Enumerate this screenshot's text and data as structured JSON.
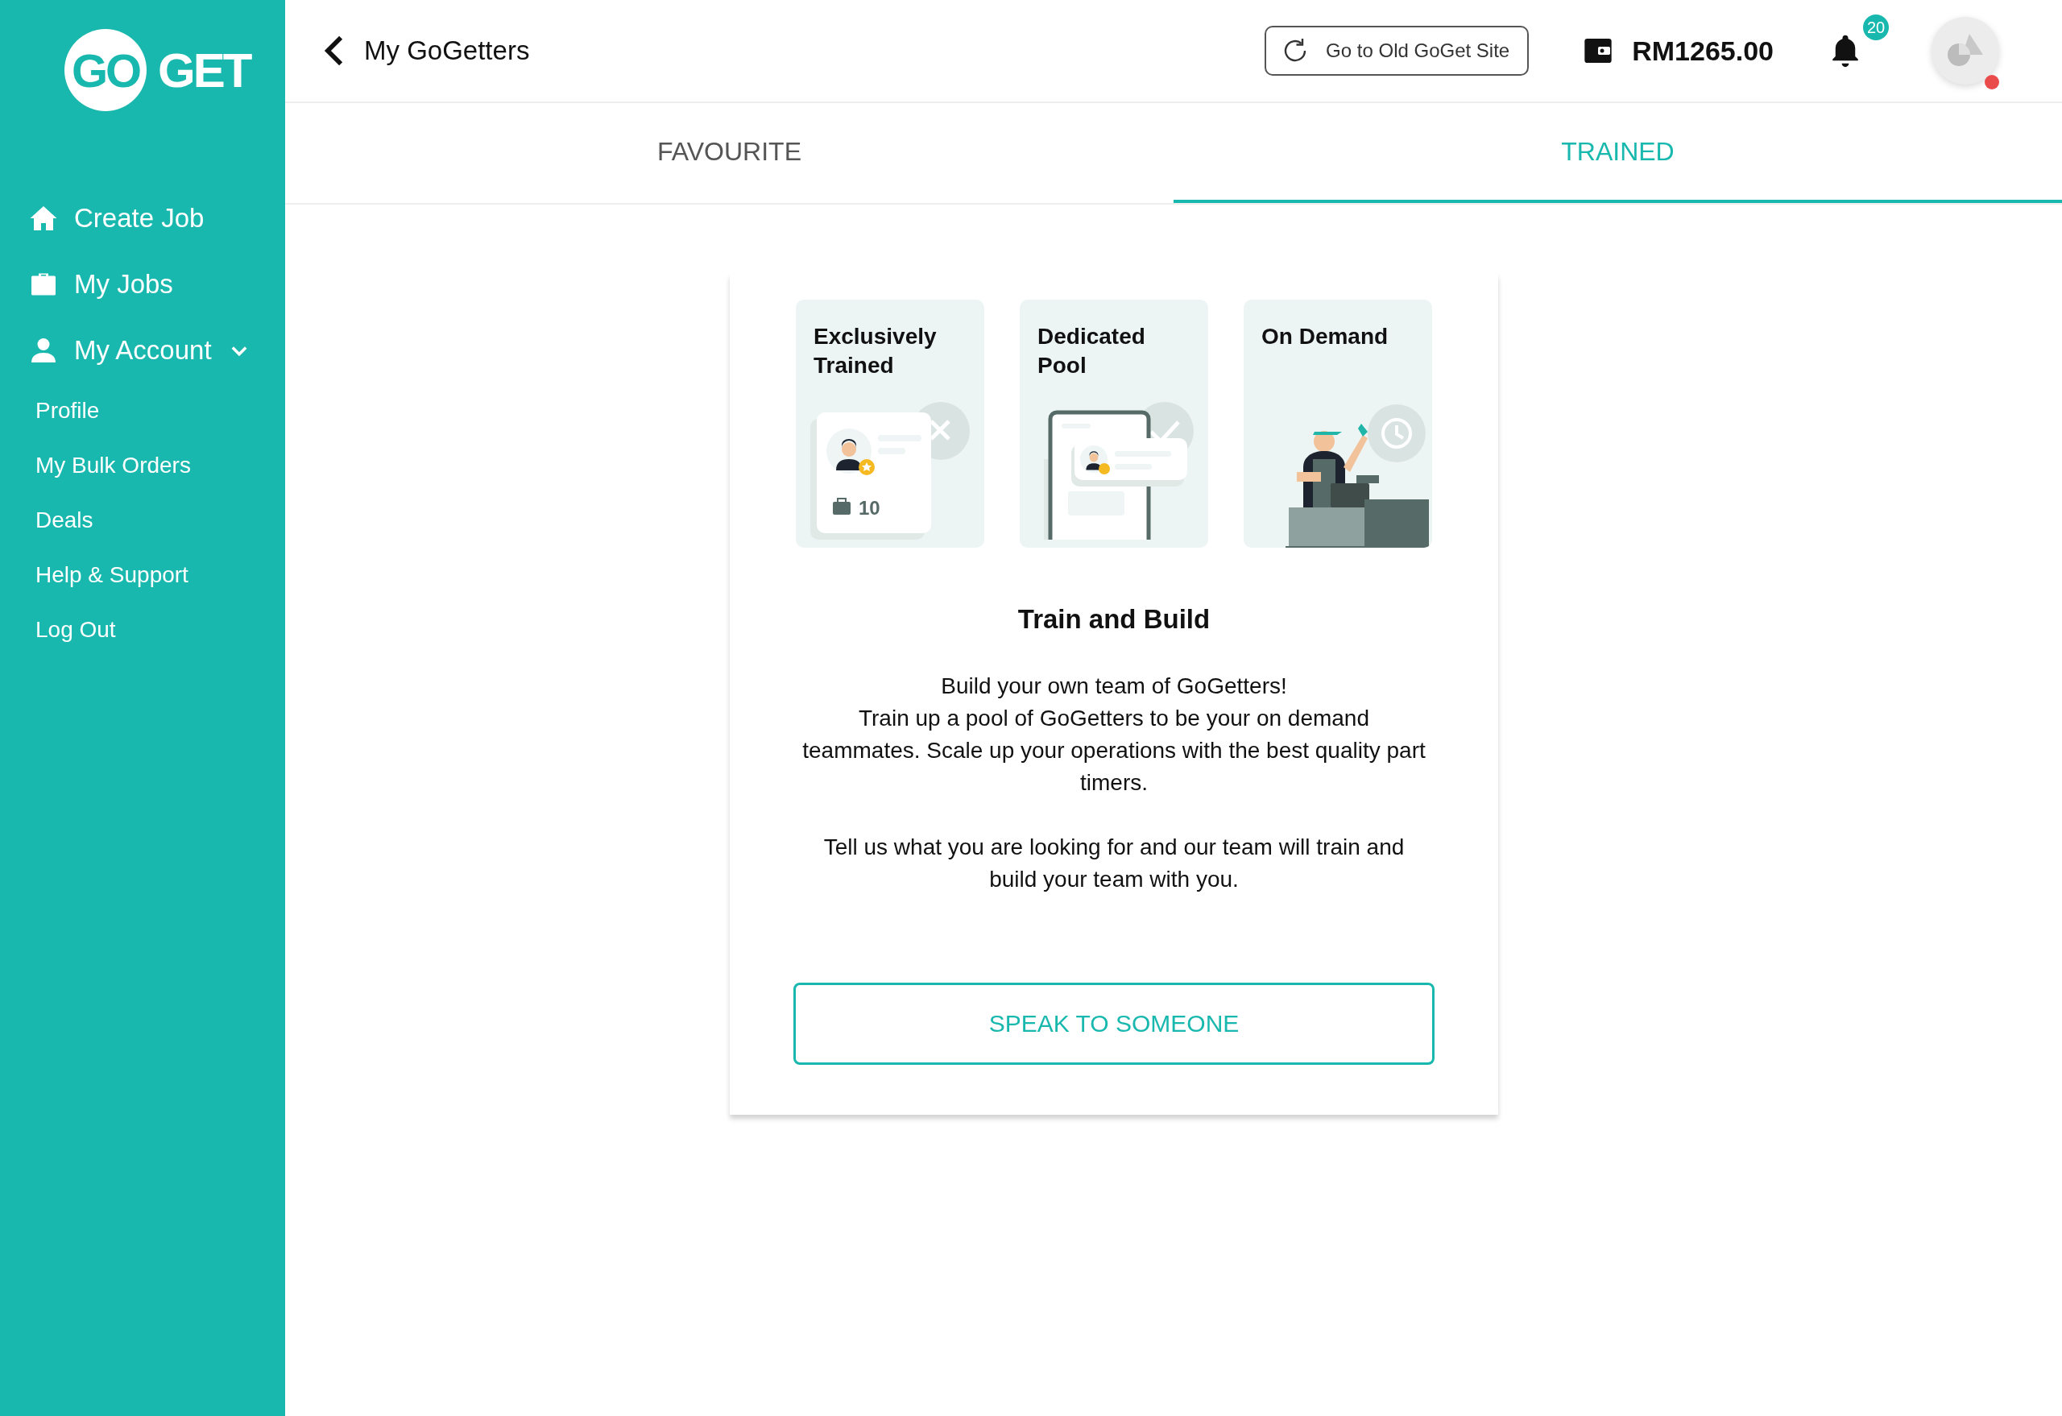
{
  "logo": {
    "left": "GO",
    "right": "GET"
  },
  "sidebar": {
    "items": [
      {
        "kind": "main",
        "label": "Create Job"
      },
      {
        "kind": "main",
        "label": "My Jobs"
      },
      {
        "kind": "group",
        "label": "My Account",
        "expanded": true,
        "children": [
          {
            "label": "Profile"
          },
          {
            "label": "My Bulk Orders"
          },
          {
            "label": "Deals"
          },
          {
            "label": "Help & Support"
          },
          {
            "label": "Log Out"
          }
        ]
      }
    ]
  },
  "header": {
    "title": "My GoGetters",
    "old_site_button": "Go to Old GoGet Site",
    "balance": "RM1265.00",
    "notification_count": "20"
  },
  "tabs": [
    {
      "label": "FAVOURITE",
      "selected": false
    },
    {
      "label": "TRAINED",
      "selected": true
    }
  ],
  "panel": {
    "tiles": [
      {
        "kind": "profile",
        "title": "Exclusively Trained",
        "count": "10"
      },
      {
        "kind": "phone",
        "title": "Dedicated Pool"
      },
      {
        "kind": "worker",
        "title": "On Demand"
      }
    ],
    "heading": "Train and Build",
    "paragraphs": [
      "Build your own team of GoGetters!\nTrain up a pool of GoGetters to be your on demand teammates. Scale up your operations with the best quality part timers.",
      "Tell us what you are looking for and our team will train and build your team with you."
    ],
    "button": "SPEAK TO SOMEONE"
  }
}
